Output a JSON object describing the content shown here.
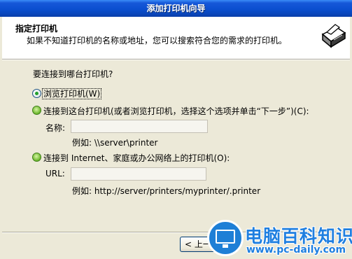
{
  "window": {
    "title": "添加打印机向导"
  },
  "header": {
    "title": "指定打印机",
    "subtitle": "如果不知道打印机的名称或地址，您可以搜索符合您的需求的打印机。",
    "icon": "printer-icon"
  },
  "content": {
    "question": "要连接到哪台打印机?",
    "options": [
      {
        "label": "浏览打印机(W)",
        "selected": true
      },
      {
        "label": "连接到这台打印机(或者浏览打印机，选择这个选项并单击“下一步”)(C):",
        "selected": false
      },
      {
        "label": "连接到 Internet、家庭或办公网络上的打印机(O):",
        "selected": false
      }
    ],
    "name_field": {
      "label": "名称:",
      "value": "",
      "example": "例如: \\\\server\\printer"
    },
    "url_field": {
      "label": "URL:",
      "value": "",
      "example": "例如: http://server/printers/myprinter/.printer"
    }
  },
  "buttons": {
    "back": "< 上一"
  },
  "watermark": {
    "title": "电脑百科知识",
    "url": "www.pc-daily.com"
  }
}
